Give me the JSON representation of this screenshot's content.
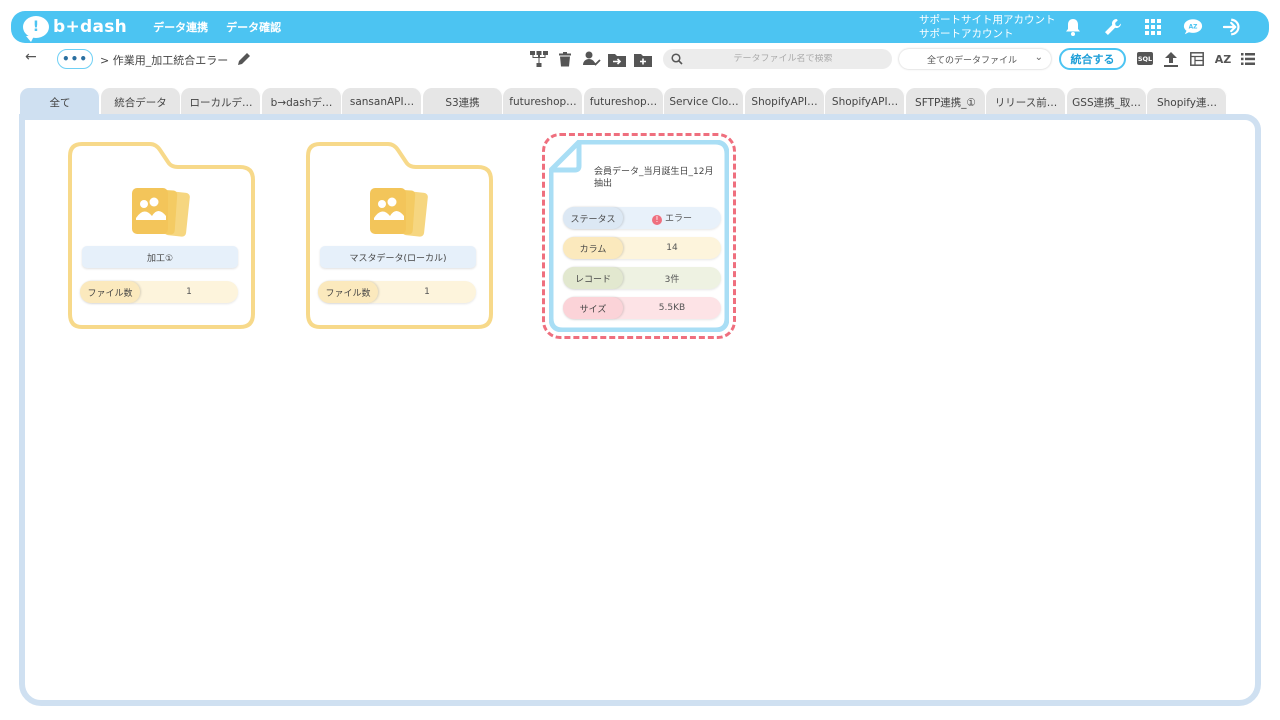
{
  "header": {
    "logo_text": "b+dash",
    "nav": [
      "データ連携",
      "データ確認"
    ],
    "account_line1": "サポートサイト用アカウント",
    "account_line2": "サポートアカウント"
  },
  "toolbar": {
    "back_symbol": "←",
    "more_symbol": "•••",
    "breadcrumb": "> 作業用_加工統合エラー",
    "search_placeholder": "データファイル名で検索",
    "filter_selected": "全てのデータファイル",
    "merge_label": "統合する",
    "sql_label": "SQL",
    "sort_label": "AZ"
  },
  "tabs": [
    {
      "label": "全て",
      "active": true
    },
    {
      "label": "統合データ"
    },
    {
      "label": "ローカルデ…"
    },
    {
      "label": "b→dashデ…"
    },
    {
      "label": "sansanAPI…"
    },
    {
      "label": "S3連携"
    },
    {
      "label": "futureshop…"
    },
    {
      "label": "futureshop…"
    },
    {
      "label": "Service Clo…"
    },
    {
      "label": "ShopifyAPI…"
    },
    {
      "label": "ShopifyAPI…"
    },
    {
      "label": "SFTP連携_①"
    },
    {
      "label": "リリース前…"
    },
    {
      "label": "GSS連携_取…"
    },
    {
      "label": "Shopify連…"
    }
  ],
  "folders": [
    {
      "name": "加工①",
      "count_label": "ファイル数",
      "count": "1"
    },
    {
      "name": "マスタデータ(ローカル)",
      "count_label": "ファイル数",
      "count": "1"
    }
  ],
  "file": {
    "title": "会員データ_当月誕生日_12月抽出",
    "stats": [
      {
        "label": "ステータス",
        "value": "エラー"
      },
      {
        "label": "カラム",
        "value": "14"
      },
      {
        "label": "レコード",
        "value": "3件"
      },
      {
        "label": "サイズ",
        "value": "5.5KB"
      }
    ]
  },
  "colors": {
    "header": "#4cc4f2",
    "folder_border": "#f7d98a",
    "file_border": "#a9def5",
    "error_dash": "#ef6f7e",
    "status_bg": "#e8f1fa",
    "column_bg": "#fdf4dc",
    "record_bg": "#eef2e2",
    "size_bg": "#fde3e6"
  },
  "icons": {
    "header": [
      "bell-icon",
      "wrench-icon",
      "grid-icon",
      "az-bubble-icon",
      "logout-icon"
    ],
    "toolbar": [
      "flow-icon",
      "trash-icon",
      "user-check-icon",
      "folder-move-icon",
      "folder-add-icon",
      "search-icon",
      "upload-icon",
      "table-icon",
      "sort-az-icon",
      "list-icon"
    ]
  }
}
